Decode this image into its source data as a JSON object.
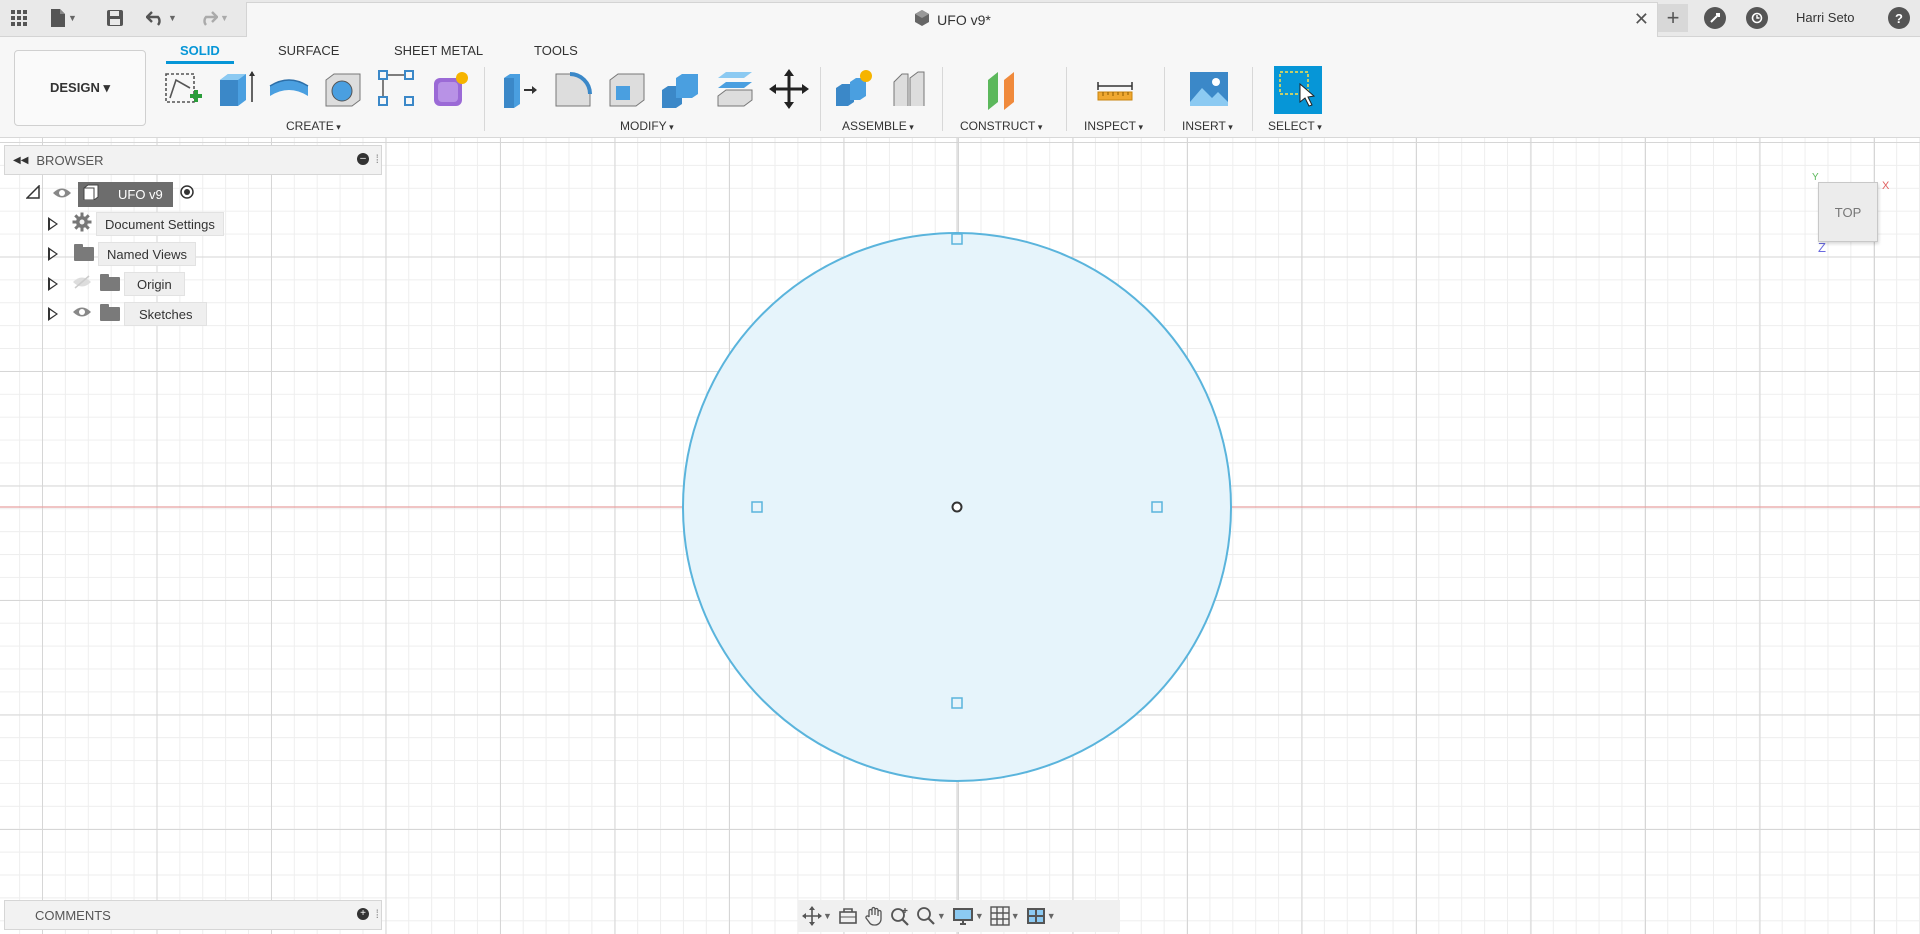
{
  "titlebar": {
    "doc_title": "UFO v9*",
    "close_glyph": "✕",
    "new_tab_glyph": "+",
    "user_name": "Harri Seto",
    "help_glyph": "?"
  },
  "ribbon": {
    "workspace_button": "DESIGN ▾",
    "tabs": [
      {
        "label": "SOLID",
        "active": true
      },
      {
        "label": "SURFACE",
        "active": false
      },
      {
        "label": "SHEET METAL",
        "active": false
      },
      {
        "label": "TOOLS",
        "active": false
      }
    ],
    "groups": {
      "create": "CREATE",
      "modify": "MODIFY",
      "assemble": "ASSEMBLE",
      "construct": "CONSTRUCT",
      "inspect": "INSPECT",
      "insert": "INSERT",
      "select": "SELECT"
    }
  },
  "browser": {
    "title": "BROWSER",
    "root": "UFO v9",
    "items": [
      {
        "label": "Document Settings",
        "icon": "gear-icon"
      },
      {
        "label": "Named Views",
        "icon": "folder-icon"
      },
      {
        "label": "Origin",
        "icon": "folder-icon",
        "hidden": true
      },
      {
        "label": "Sketches",
        "icon": "folder-icon"
      }
    ]
  },
  "comments": {
    "title": "COMMENTS"
  },
  "viewcube": {
    "face": "TOP",
    "axis_x": "X",
    "axis_y": "Y",
    "axis_z": "Z"
  },
  "colors": {
    "accent": "#0696d7",
    "sketch_stroke": "#5ab4dc",
    "sketch_fill": "#e6f4fb",
    "x_axis": "#e8a0a0"
  }
}
